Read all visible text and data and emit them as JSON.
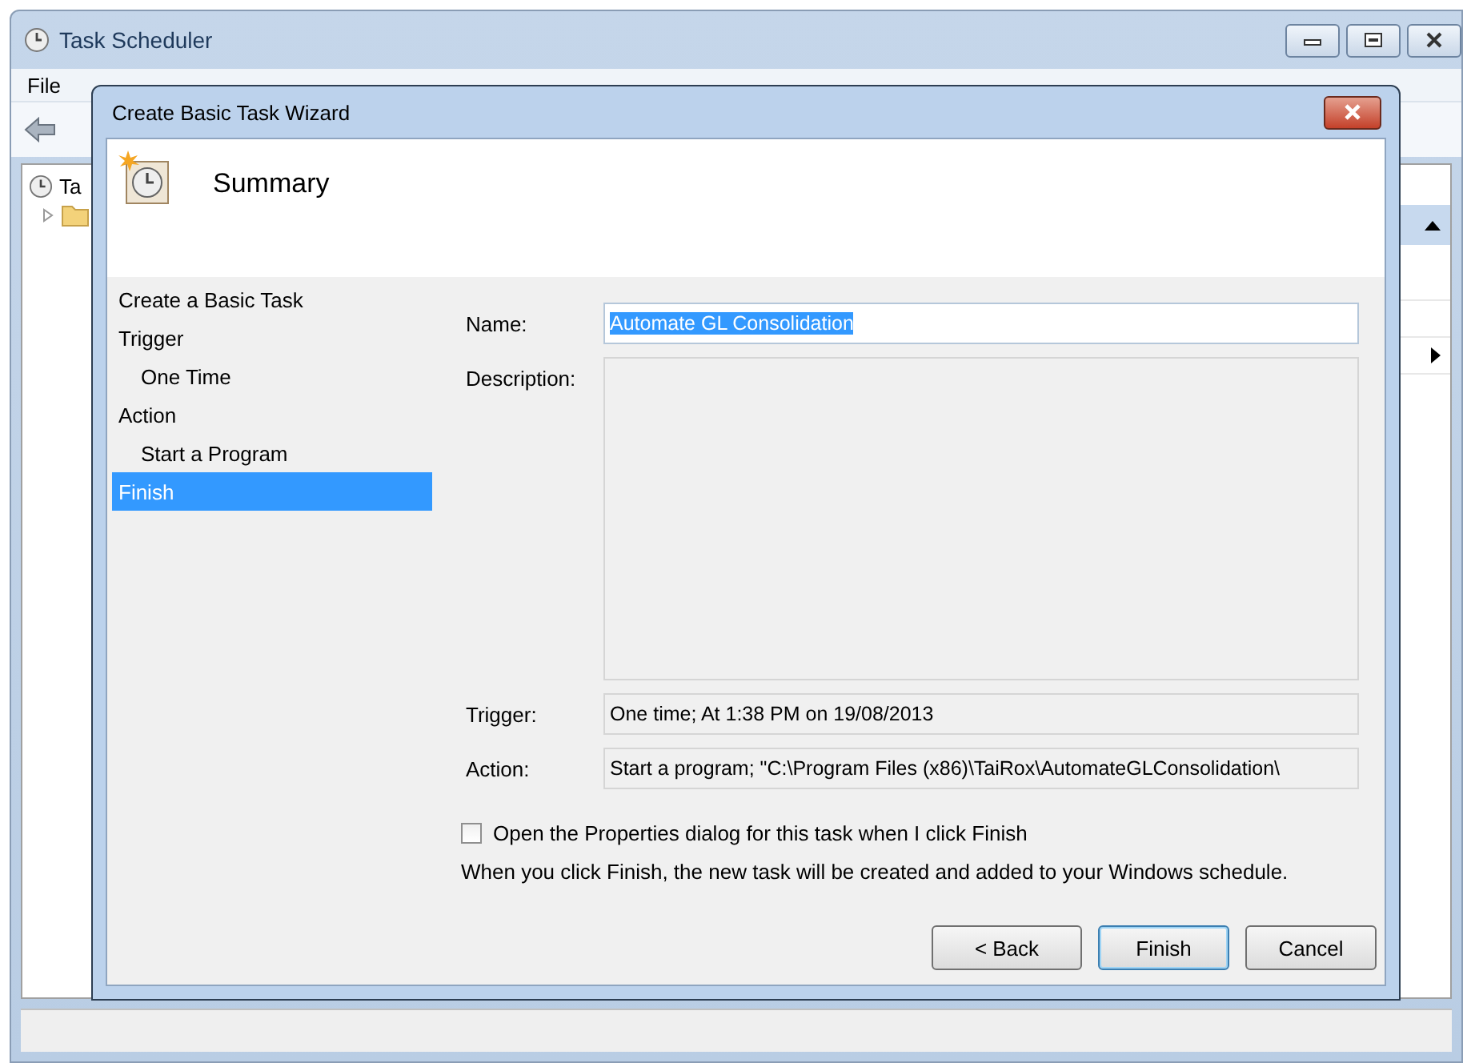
{
  "main_window": {
    "title": "Task Scheduler",
    "menu": [
      "File"
    ],
    "tree": [
      {
        "label": "Ta",
        "expanded": true,
        "children": [
          {
            "expanded": false
          }
        ]
      }
    ],
    "actions_pane": {
      "items": [
        {
          "kind": "row"
        },
        {
          "kind": "row"
        },
        {
          "kind": "submenu"
        }
      ]
    }
  },
  "dialog": {
    "title": "Create Basic Task Wizard",
    "heading": "Summary",
    "steps": [
      {
        "label": "Create a Basic Task",
        "selected": false
      },
      {
        "label": "Trigger",
        "selected": false,
        "children": [
          {
            "label": "One Time",
            "selected": false
          }
        ]
      },
      {
        "label": "Action",
        "selected": false,
        "children": [
          {
            "label": "Start a Program",
            "selected": false
          }
        ]
      },
      {
        "label": "Finish",
        "selected": true
      }
    ],
    "fields": [
      {
        "kind": "line",
        "label": "Name:",
        "value": "Automate GL Consolidation",
        "text_selected": true,
        "read_only": false
      },
      {
        "kind": "area",
        "label": "Description:",
        "read_only": true
      },
      {
        "kind": "line",
        "label": "Trigger:",
        "value": "One time; At 1:38 PM on 19/08/2013",
        "text_selected": false,
        "read_only": true
      },
      {
        "kind": "line",
        "label": "Action:",
        "value": "Start a program; \"C:\\Program Files (x86)\\TaiRox\\AutomateGLConsolidation\\",
        "text_selected": false,
        "read_only": true
      }
    ],
    "checkbox": {
      "label": "Open the Properties dialog for this task when I click Finish",
      "checked": false
    },
    "note": "When you click Finish, the new task will be created and added to your Windows schedule.",
    "buttons": [
      {
        "label": "< Back",
        "default": false
      },
      {
        "label": "Finish",
        "default": true
      },
      {
        "label": "Cancel",
        "default": false
      }
    ]
  }
}
